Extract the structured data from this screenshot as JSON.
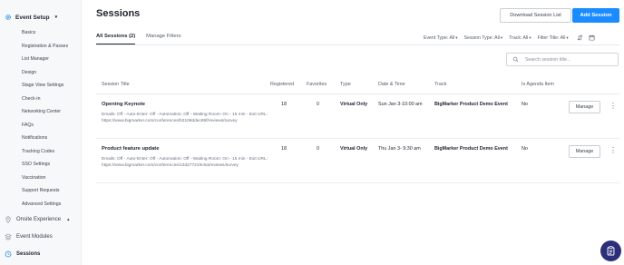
{
  "sidebar": {
    "header": {
      "label": "Event Setup",
      "icon": "gear-icon"
    },
    "items": [
      {
        "label": "Basics"
      },
      {
        "label": "Registration & Passes"
      },
      {
        "label": "List Manager"
      },
      {
        "label": "Design"
      },
      {
        "label": "Stage View Settings"
      },
      {
        "label": "Check-in"
      },
      {
        "label": "Networking Center"
      },
      {
        "label": "FAQs"
      },
      {
        "label": "Notifications"
      },
      {
        "label": "Tracking Codes"
      },
      {
        "label": "SSO Settings"
      },
      {
        "label": "Vaccination"
      },
      {
        "label": "Support Requests"
      },
      {
        "label": "Advanced Settings"
      }
    ],
    "sections": [
      {
        "label": "Onsite Experience",
        "icon": "location-pin-icon"
      },
      {
        "label": "Event Modules",
        "icon": "layers-icon"
      },
      {
        "label": "Sessions",
        "icon": "clock-icon"
      }
    ]
  },
  "header": {
    "title": "Sessions",
    "download_label": "Download Session List",
    "add_label": "Add Session"
  },
  "tabs": [
    {
      "label": "All Sessions (2)"
    },
    {
      "label": "Manage Filters"
    }
  ],
  "filters": [
    {
      "label": "Event Type: All"
    },
    {
      "label": "Session Type: All"
    },
    {
      "label": "Track: All"
    },
    {
      "label": "Filter Title: All"
    }
  ],
  "search": {
    "placeholder": "Search session title..."
  },
  "table": {
    "columns": [
      "Session Title",
      "Registered",
      "Favorites",
      "Type",
      "Date & Time",
      "Track",
      "Is Agenda Item"
    ],
    "rows": [
      {
        "title": "Opening Keynote",
        "desc": "Emails: Off - Auto-Enter: Off - Automation: Off - Waiting Room: On - 15 min - Exit URL: https://www.bigmarker.com/conferences/b3108ddec89f/reviews/survey",
        "registered": "18",
        "favorites": "0",
        "type": "Virtual Only",
        "datetime": "Sun Jan 3-10:00 am",
        "track": "BigMarker Product Demo Event",
        "agenda": "No",
        "manage": "Manage"
      },
      {
        "title": "Product feature update",
        "desc": "Emails: Off - Auto-Enter: Off - Automation: Off - Waiting Room: On - 15 min - Exit URL: https://www.bigmarker.com/conferences/13d277219c5a/reviews/survey",
        "registered": "18",
        "favorites": "0",
        "type": "Virtual Only",
        "datetime": "Thu Jan 3- 9:30 am",
        "track": "BigMarker Product Demo Event",
        "agenda": "No",
        "manage": "Manage"
      }
    ]
  },
  "colors": {
    "accent": "#1a8cff",
    "sidebar_icon": "#2d8ce8",
    "fab": "#2b2f7a"
  }
}
